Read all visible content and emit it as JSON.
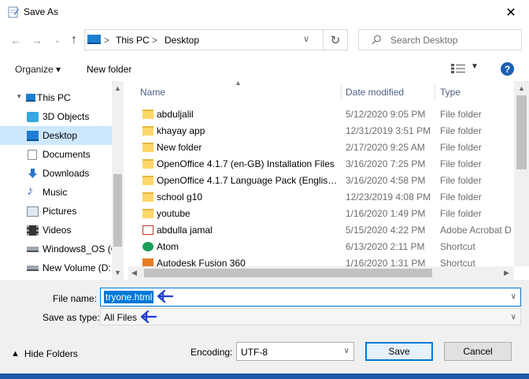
{
  "window": {
    "title": "Save As",
    "icon": "save-as-icon",
    "close_glyph": "✕"
  },
  "nav": {
    "back_glyph": "←",
    "forward_glyph": "→",
    "up_glyph": "⌄",
    "uparrow_glyph": "↑",
    "address": {
      "segments": [
        "This PC",
        "Desktop"
      ],
      "separator": ">",
      "refresh_glyph": "↻",
      "dropdown_glyph": "∨"
    },
    "search": {
      "placeholder": "Search Desktop",
      "icon": "search-icon"
    }
  },
  "toolbar": {
    "organize_label": "Organize ▾",
    "new_folder_label": "New folder",
    "help_label": "?"
  },
  "navpane": {
    "items": [
      {
        "label": "This PC",
        "icon": "pc-icon",
        "indent": 1
      },
      {
        "label": "3D Objects",
        "icon": "3d-objects-icon",
        "indent": 2
      },
      {
        "label": "Desktop",
        "icon": "desktop-icon",
        "indent": 2,
        "selected": true
      },
      {
        "label": "Documents",
        "icon": "documents-icon",
        "indent": 2
      },
      {
        "label": "Downloads",
        "icon": "downloads-icon",
        "indent": 2
      },
      {
        "label": "Music",
        "icon": "music-icon",
        "indent": 2
      },
      {
        "label": "Pictures",
        "icon": "pictures-icon",
        "indent": 2
      },
      {
        "label": "Videos",
        "icon": "videos-icon",
        "indent": 2
      },
      {
        "label": "Windows8_OS (C",
        "icon": "drive-icon",
        "indent": 2
      },
      {
        "label": "New Volume (D:",
        "icon": "drive-icon",
        "indent": 2
      }
    ]
  },
  "files": {
    "columns": {
      "name": "Name",
      "date": "Date modified",
      "type": "Type"
    },
    "rows": [
      {
        "name": "abduljalil",
        "date": "5/12/2020 9:05 PM",
        "type": "File folder",
        "icon": "folder-icon"
      },
      {
        "name": "khayay app",
        "date": "12/31/2019 3:51 PM",
        "type": "File folder",
        "icon": "folder-icon"
      },
      {
        "name": "New folder",
        "date": "2/17/2020 9:25 AM",
        "type": "File folder",
        "icon": "folder-icon"
      },
      {
        "name": "OpenOffice 4.1.7 (en-GB) Installation Files",
        "date": "3/16/2020 7:25 PM",
        "type": "File folder",
        "icon": "folder-icon"
      },
      {
        "name": "OpenOffice 4.1.7 Language Pack (English...",
        "date": "3/16/2020 4:58 PM",
        "type": "File folder",
        "icon": "folder-icon"
      },
      {
        "name": "school g10",
        "date": "12/23/2019 4:08 PM",
        "type": "File folder",
        "icon": "folder-icon"
      },
      {
        "name": "youtube",
        "date": "1/16/2020 1:49 PM",
        "type": "File folder",
        "icon": "folder-icon"
      },
      {
        "name": "abdulla jamal",
        "date": "5/15/2020 4:22 PM",
        "type": "Adobe Acrobat D",
        "icon": "pdf-icon"
      },
      {
        "name": "Atom",
        "date": "6/13/2020 2:11 PM",
        "type": "Shortcut",
        "icon": "atom-shortcut-icon"
      },
      {
        "name": "Autodesk Fusion 360",
        "date": "1/16/2020 1:31 PM",
        "type": "Shortcut",
        "icon": "fusion-shortcut-icon"
      }
    ]
  },
  "form": {
    "filename_label": "File name:",
    "filename_value": "tryone.html",
    "savetype_label": "Save as type:",
    "savetype_value": "All Files",
    "hide_folders_label": "Hide Folders",
    "encoding_label": "Encoding:",
    "encoding_value": "UTF-8",
    "save_label": "Save",
    "cancel_label": "Cancel"
  },
  "colors": {
    "accent": "#0078d7",
    "selection": "#cce8ff",
    "annotation": "#1f3fd6"
  }
}
